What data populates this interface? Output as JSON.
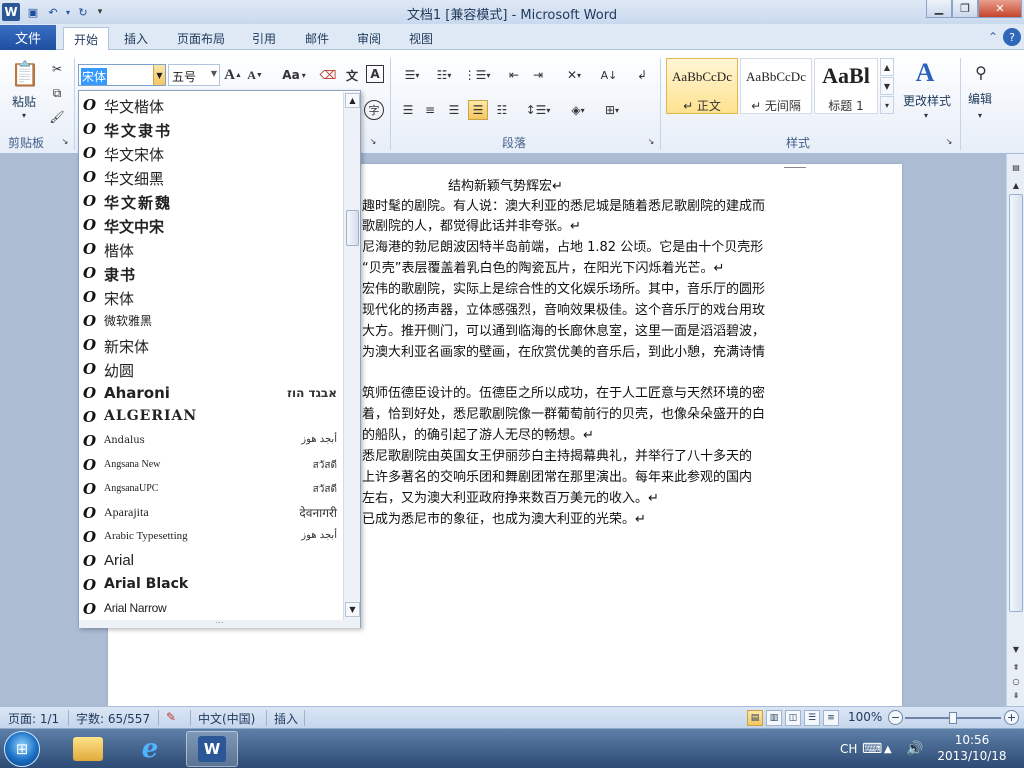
{
  "window": {
    "title": "文档1 [兼容模式] - Microsoft Word",
    "min_icon": "minimize-icon",
    "max_icon": "maximize-icon",
    "close_icon": "close-icon"
  },
  "ribbon_tabs": [
    {
      "label": "文件"
    },
    {
      "label": "开始"
    },
    {
      "label": "插入"
    },
    {
      "label": "页面布局"
    },
    {
      "label": "引用"
    },
    {
      "label": "邮件"
    },
    {
      "label": "审阅"
    },
    {
      "label": "视图"
    }
  ],
  "ribbon": {
    "clipboard": {
      "paste": "粘贴",
      "group": "剪贴板"
    },
    "font": {
      "name": "宋体",
      "size": "五号",
      "grow": "A",
      "shrink": "A",
      "case": "Aa"
    },
    "paragraph": {
      "group": "段落"
    },
    "styles": {
      "group": "样式",
      "items": [
        {
          "sample": "AaBbCcDc",
          "name": "↵ 正文"
        },
        {
          "sample": "AaBbCcDc",
          "name": "↵ 无间隔"
        },
        {
          "sample": "AaBl",
          "name": "标题 1"
        }
      ],
      "change_styles": "更改样式"
    },
    "editing": {
      "label": "编辑"
    }
  },
  "font_list": [
    {
      "name": "华文楷体",
      "sample": ""
    },
    {
      "name": "华文隶书",
      "sample": ""
    },
    {
      "name": "华文宋体",
      "sample": ""
    },
    {
      "name": "华文细黑",
      "sample": ""
    },
    {
      "name": "华文新魏",
      "sample": ""
    },
    {
      "name": "华文中宋",
      "sample": ""
    },
    {
      "name": "楷体",
      "sample": ""
    },
    {
      "name": "隶书",
      "sample": ""
    },
    {
      "name": "宋体",
      "sample": ""
    },
    {
      "name": "微软雅黑",
      "sample": ""
    },
    {
      "name": "新宋体",
      "sample": ""
    },
    {
      "name": "幼圆",
      "sample": ""
    },
    {
      "name": "Aharoni",
      "sample": "אבגד הוז"
    },
    {
      "name": "ALGERIAN",
      "sample": ""
    },
    {
      "name": "Andalus",
      "sample": "أبجد هوز"
    },
    {
      "name": "Angsana New",
      "sample": "สวัสดี"
    },
    {
      "name": "AngsanaUPC",
      "sample": "สวัสดี"
    },
    {
      "name": "Aparajita",
      "sample": "देवनागरी"
    },
    {
      "name": "Arabic Typesetting",
      "sample": "أبجد هوز"
    },
    {
      "name": "Arial",
      "sample": ""
    },
    {
      "name": "Arial Black",
      "sample": ""
    },
    {
      "name": "Arial Narrow",
      "sample": ""
    }
  ],
  "document": {
    "title": "结构新颖气势辉宏↵",
    "lines": [
      "趣时髦的剧院。有人说：澳大利亚的悉尼城是随着悉尼歌剧院的建成而",
      "歌剧院的人，都觉得此话并非夸张。↵",
      "尼海港的勃尼朗波因特半岛前端，占地 1.82 公顷。它是由十个贝壳形",
      "“贝壳”表层覆盖着乳白色的陶瓷瓦片，在阳光下闪烁着光芒。↵",
      "宏伟的歌剧院，实际上是综合性的文化娱乐场所。其中，音乐厅的圆形",
      "现代化的扬声器，立体感强烈，音响效果极佳。这个音乐厅的戏台用玫",
      "大方。推开侧门，可以通到临海的长廊休息室，这里一面是滔滔碧波，",
      "为澳大利亚名画家的壁画，在欣赏优美的音乐后，到此小憩，充满诗情",
      "筑师伍德臣设计的。伍德臣之所以成功，在于人工匠意与天然环境的密",
      "着，恰到好处，悉尼歌剧院像一群葡萄前行的贝壳，也像朵朵盛开的白",
      "的船队，的确引起了游人无尽的畅想。↵",
      "悉尼歌剧院由英国女王伊丽莎白主持揭幕典礼，并举行了八十多天的",
      "上许多著名的交响乐团和舞剧团常在那里演出。每年来此参观的国内",
      "左右，又为澳大利亚政府挣来数百万美元的收入。↵",
      "已成为悉尼市的象征，也成为澳大利亚的光荣。↵"
    ]
  },
  "status": {
    "page": "页面: 1/1",
    "words": "字数: 65/557",
    "language": "中文(中国)",
    "mode": "插入",
    "zoom": "100%",
    "zoom_minus": "−",
    "zoom_plus": "+",
    "zoom_fraction": 0.5
  },
  "taskbar": {
    "ime": "CH",
    "time": "10:56",
    "date": "2013/10/18",
    "word_icon_label": "W",
    "ie_icon_label": "e"
  },
  "colors": {
    "accent": "#2b5797",
    "file_tab": "#1e4f9f",
    "highlight": "#3399ff",
    "selected_style": "#ffe291"
  }
}
